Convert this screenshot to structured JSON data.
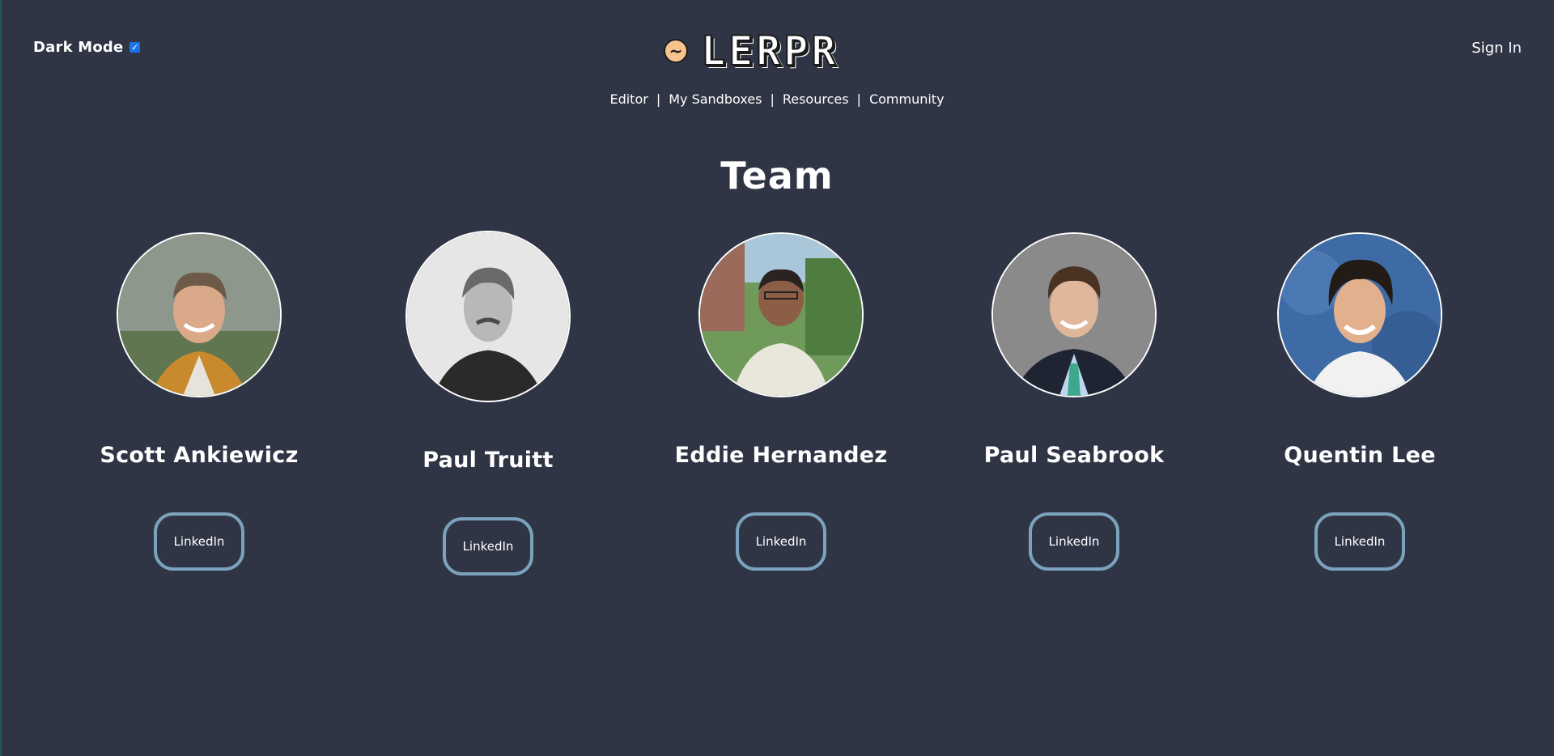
{
  "header": {
    "dark_mode_label": "Dark Mode",
    "dark_mode_checked": true,
    "logo_symbol": "~",
    "logo_text": "LERPR",
    "sign_in_label": "Sign In"
  },
  "nav": {
    "items": [
      "Editor",
      "My Sandboxes",
      "Resources",
      "Community"
    ],
    "separator": "|"
  },
  "page_title": "Team",
  "members": [
    {
      "name": "Scott Ankiewicz",
      "link_label": "LinkedIn"
    },
    {
      "name": "Paul Truitt",
      "link_label": "LinkedIn"
    },
    {
      "name": "Eddie Hernandez",
      "link_label": "LinkedIn"
    },
    {
      "name": "Paul Seabrook",
      "link_label": "LinkedIn"
    },
    {
      "name": "Quentin Lee",
      "link_label": "LinkedIn"
    }
  ],
  "colors": {
    "background": "#303546",
    "button_border": "#7ba3bd",
    "logo_accent": "#f7c48e",
    "checkbox": "#1a73e8"
  }
}
